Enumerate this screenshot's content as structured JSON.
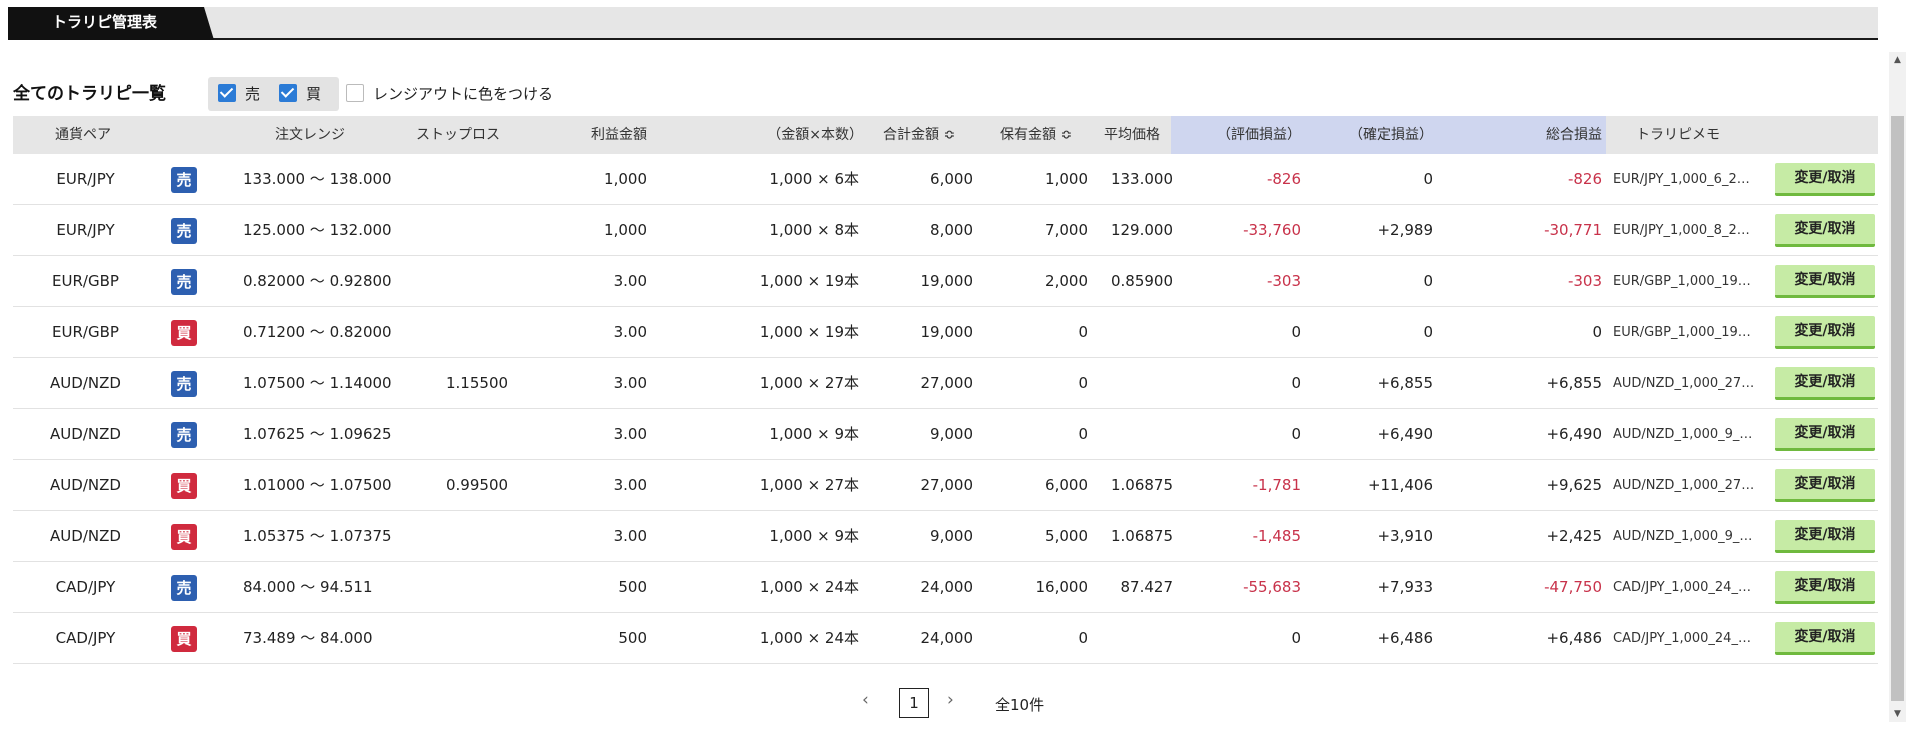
{
  "tab": {
    "label": "トラリピ管理表"
  },
  "section": {
    "title": "全てのトラリピ一覧"
  },
  "filters": {
    "sell_label": "売",
    "buy_label": "買",
    "range_color_label": "レンジアウトに色をつける",
    "sell_checked": true,
    "buy_checked": true,
    "range_color_checked": false
  },
  "columns": {
    "pair": "通貨ペア",
    "range": "注文レンジ",
    "stop": "ストップロス",
    "profit": "利益金額",
    "amount": "（金額×本数）",
    "total": "合計金額 ≎",
    "held": "保有金額 ≎",
    "avg": "平均価格",
    "unrealized": "（評価損益）",
    "realized": "（確定損益）",
    "net": "総合損益",
    "memo": "トラリピメモ"
  },
  "rows": [
    {
      "pair": "EUR/JPY",
      "side": "売",
      "side_type": "sell",
      "range": "133.000 〜 138.000",
      "stop": "",
      "profit": "1,000",
      "amount": "1,000 × 6本",
      "total": "6,000",
      "held": "1,000",
      "avg": "133.000",
      "unrealized": "-826",
      "realized": "0",
      "net": "-826",
      "memo": "EUR/JPY_1,000_6_2…",
      "action": "変更/取消"
    },
    {
      "pair": "EUR/JPY",
      "side": "売",
      "side_type": "sell",
      "range": "125.000 〜 132.000",
      "stop": "",
      "profit": "1,000",
      "amount": "1,000 × 8本",
      "total": "8,000",
      "held": "7,000",
      "avg": "129.000",
      "unrealized": "-33,760",
      "realized": "+2,989",
      "net": "-30,771",
      "memo": "EUR/JPY_1,000_8_2…",
      "action": "変更/取消"
    },
    {
      "pair": "EUR/GBP",
      "side": "売",
      "side_type": "sell",
      "range": "0.82000 〜 0.92800",
      "stop": "",
      "profit": "3.00",
      "amount": "1,000 × 19本",
      "total": "19,000",
      "held": "2,000",
      "avg": "0.85900",
      "unrealized": "-303",
      "realized": "0",
      "net": "-303",
      "memo": "EUR/GBP_1,000_19…",
      "action": "変更/取消"
    },
    {
      "pair": "EUR/GBP",
      "side": "買",
      "side_type": "buy",
      "range": "0.71200 〜 0.82000",
      "stop": "",
      "profit": "3.00",
      "amount": "1,000 × 19本",
      "total": "19,000",
      "held": "0",
      "avg": "",
      "unrealized": "0",
      "realized": "0",
      "net": "0",
      "memo": "EUR/GBP_1,000_19…",
      "action": "変更/取消"
    },
    {
      "pair": "AUD/NZD",
      "side": "売",
      "side_type": "sell",
      "range": "1.07500 〜 1.14000",
      "stop": "1.15500",
      "profit": "3.00",
      "amount": "1,000 × 27本",
      "total": "27,000",
      "held": "0",
      "avg": "",
      "unrealized": "0",
      "realized": "+6,855",
      "net": "+6,855",
      "memo": "AUD/NZD_1,000_27…",
      "action": "変更/取消"
    },
    {
      "pair": "AUD/NZD",
      "side": "売",
      "side_type": "sell",
      "range": "1.07625 〜 1.09625",
      "stop": "",
      "profit": "3.00",
      "amount": "1,000 × 9本",
      "total": "9,000",
      "held": "0",
      "avg": "",
      "unrealized": "0",
      "realized": "+6,490",
      "net": "+6,490",
      "memo": "AUD/NZD_1,000_9_…",
      "action": "変更/取消"
    },
    {
      "pair": "AUD/NZD",
      "side": "買",
      "side_type": "buy",
      "range": "1.01000 〜 1.07500",
      "stop": "0.99500",
      "profit": "3.00",
      "amount": "1,000 × 27本",
      "total": "27,000",
      "held": "6,000",
      "avg": "1.06875",
      "unrealized": "-1,781",
      "realized": "+11,406",
      "net": "+9,625",
      "memo": "AUD/NZD_1,000_27…",
      "action": "変更/取消"
    },
    {
      "pair": "AUD/NZD",
      "side": "買",
      "side_type": "buy",
      "range": "1.05375 〜 1.07375",
      "stop": "",
      "profit": "3.00",
      "amount": "1,000 × 9本",
      "total": "9,000",
      "held": "5,000",
      "avg": "1.06875",
      "unrealized": "-1,485",
      "realized": "+3,910",
      "net": "+2,425",
      "memo": "AUD/NZD_1,000_9_…",
      "action": "変更/取消"
    },
    {
      "pair": "CAD/JPY",
      "side": "売",
      "side_type": "sell",
      "range": "84.000 〜 94.511",
      "stop": "",
      "profit": "500",
      "amount": "1,000 × 24本",
      "total": "24,000",
      "held": "16,000",
      "avg": "87.427",
      "unrealized": "-55,683",
      "realized": "+7,933",
      "net": "-47,750",
      "memo": "CAD/JPY_1,000_24_…",
      "action": "変更/取消"
    },
    {
      "pair": "CAD/JPY",
      "side": "買",
      "side_type": "buy",
      "range": "73.489 〜 84.000",
      "stop": "",
      "profit": "500",
      "amount": "1,000 × 24本",
      "total": "24,000",
      "held": "0",
      "avg": "",
      "unrealized": "0",
      "realized": "+6,486",
      "net": "+6,486",
      "memo": "CAD/JPY_1,000_24_…",
      "action": "変更/取消"
    }
  ],
  "pager": {
    "prev": "‹",
    "page": "1",
    "next": "›",
    "total": "全10件"
  },
  "colors": {
    "negative": "#c8324a",
    "sell_badge": "#2d5fb0",
    "buy_badge": "#d02a3e",
    "action_button": "#c6eba5",
    "highlight_header": "#cfd6ef"
  }
}
